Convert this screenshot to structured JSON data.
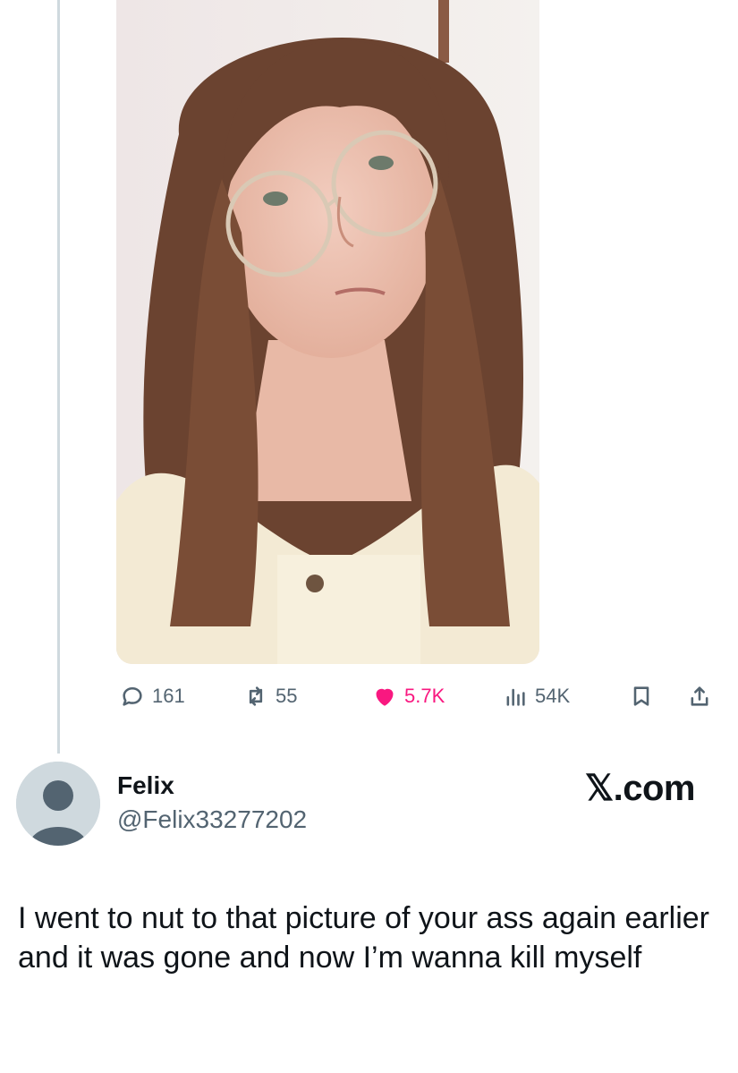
{
  "tweet": {
    "media_description": "selfie photo",
    "stats": {
      "replies": "161",
      "reposts": "55",
      "likes": "5.7K",
      "views": "54K"
    },
    "colors": {
      "like": "#f91880",
      "icon": "#536471",
      "thread_line": "#cfd9de"
    },
    "icons": [
      "reply-icon",
      "repost-icon",
      "like-icon",
      "views-icon",
      "bookmark-icon",
      "share-icon"
    ]
  },
  "card": {
    "name": "Felix",
    "handle": "@Felix33277202",
    "brand": "𝕏.com",
    "text": "I went to nut to that picture of your ass again earlier and it was gone and now I’m wanna kill myself"
  }
}
